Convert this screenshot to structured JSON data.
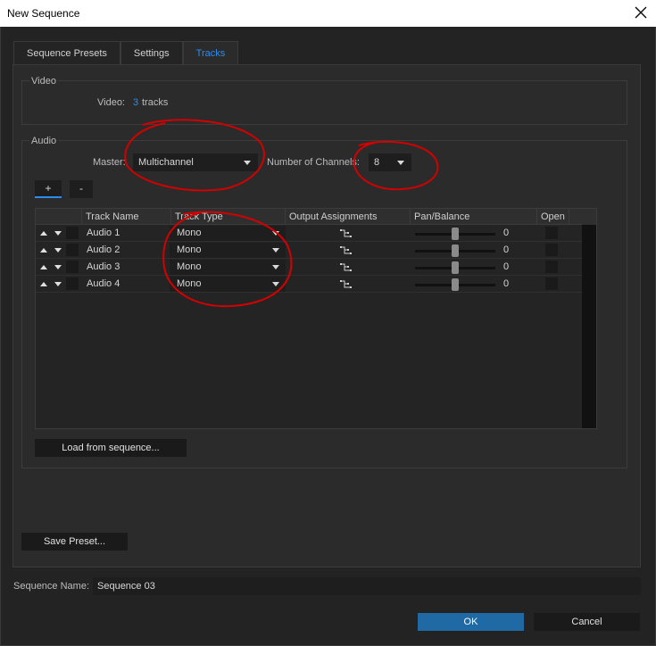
{
  "window": {
    "title": "New Sequence"
  },
  "tabs": [
    {
      "label": "Sequence Presets",
      "active": false
    },
    {
      "label": "Settings",
      "active": false
    },
    {
      "label": "Tracks",
      "active": true
    }
  ],
  "video": {
    "group_label": "Video",
    "field_label": "Video:",
    "track_count": "3",
    "tracks_suffix": "tracks"
  },
  "audio": {
    "group_label": "Audio",
    "master_label": "Master:",
    "master_value": "Multichannel",
    "channels_label": "Number of Channels:",
    "channels_value": "8",
    "add_label": "+",
    "remove_label": "-",
    "columns": [
      "Track Name",
      "Track Type",
      "Output Assignments",
      "Pan/Balance",
      "Open"
    ],
    "tracks": [
      {
        "name": "Audio 1",
        "type": "Mono",
        "pan": "0"
      },
      {
        "name": "Audio 2",
        "type": "Mono",
        "pan": "0"
      },
      {
        "name": "Audio 3",
        "type": "Mono",
        "pan": "0"
      },
      {
        "name": "Audio 4",
        "type": "Mono",
        "pan": "0"
      }
    ],
    "load_label": "Load from sequence..."
  },
  "save_preset_label": "Save Preset...",
  "sequence_name": {
    "label": "Sequence Name:",
    "value": "Sequence 03"
  },
  "ok_label": "OK",
  "cancel_label": "Cancel",
  "colors": {
    "accent": "#2d8ceb",
    "ok_button": "#1f6aa5",
    "annotation": "#d40000"
  },
  "icons": [
    "close-icon",
    "caret-down-icon",
    "arrow-up-icon",
    "arrow-down-icon",
    "output-assign-icon"
  ]
}
